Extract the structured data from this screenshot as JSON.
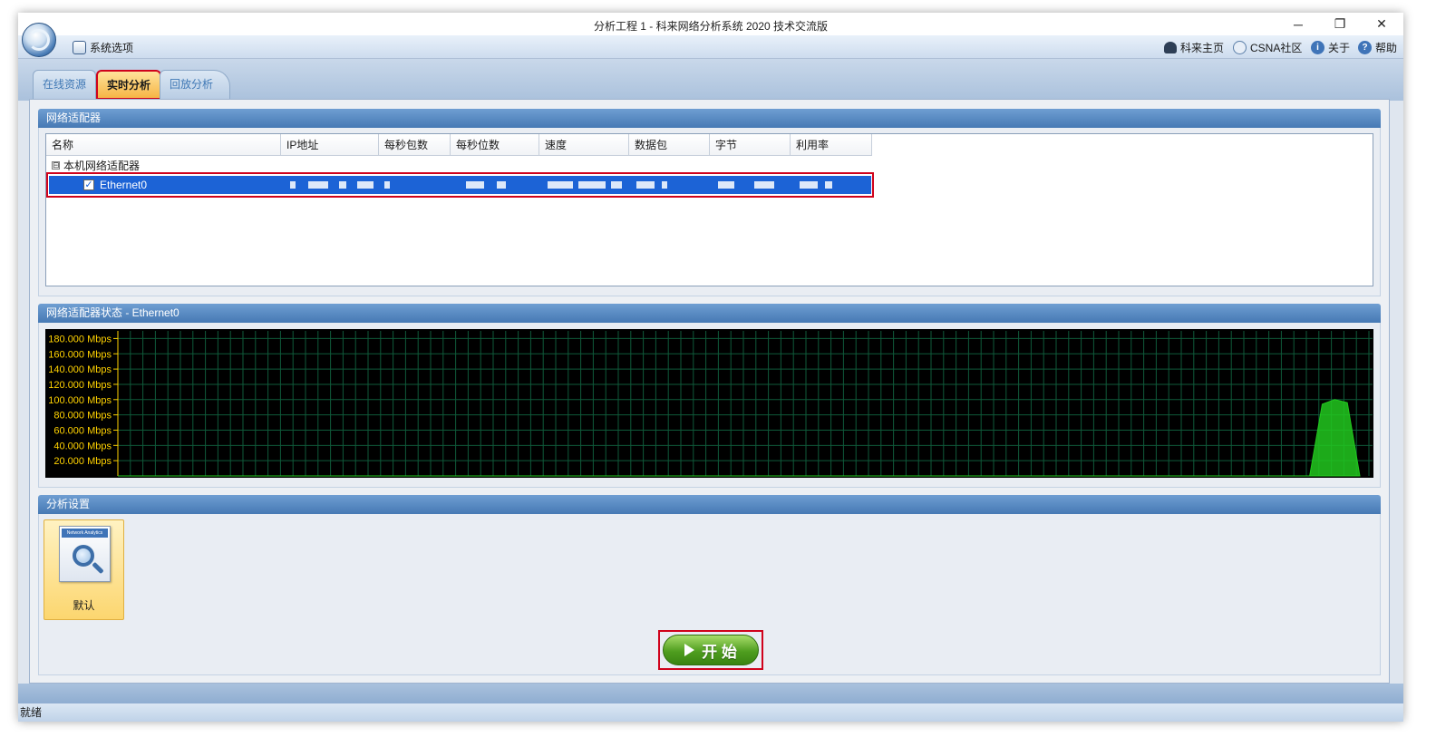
{
  "window": {
    "title": "分析工程 1 - 科来网络分析系统 2020 技术交流版",
    "controls": {
      "minimize": "─",
      "restore": "❐",
      "close": "✕"
    }
  },
  "menubar": {
    "left": [
      {
        "label": "系统选项",
        "icon": "settings-window-icon"
      }
    ],
    "right": [
      {
        "label": "科来主页",
        "icon": "home-logo-icon"
      },
      {
        "label": "CSNA社区",
        "icon": "community-icon"
      },
      {
        "label": "关于",
        "icon": "info-icon"
      },
      {
        "label": "帮助",
        "icon": "help-icon"
      }
    ]
  },
  "tabs": [
    {
      "label": "在线资源",
      "active": false
    },
    {
      "label": "实时分析",
      "active": true
    },
    {
      "label": "回放分析",
      "active": false
    }
  ],
  "adapters_section": {
    "title": "网络适配器",
    "columns": [
      "名称",
      "IP地址",
      "每秒包数",
      "每秒位数",
      "速度",
      "数据包",
      "字节",
      "利用率"
    ],
    "group_label": "本机网络适配器",
    "group_expander": "⊟",
    "rows": [
      {
        "name": "Ethernet0",
        "checked": true,
        "checkmark": "✓"
      }
    ]
  },
  "status_section": {
    "title": "网络适配器状态 - Ethernet0"
  },
  "chart_data": {
    "type": "area",
    "y_tick_labels": [
      "180.000 Mbps",
      "160.000 Mbps",
      "140.000 Mbps",
      "120.000 Mbps",
      "100.000 Mbps",
      "80.000 Mbps",
      "60.000 Mbps",
      "40.000 Mbps",
      "20.000 Mbps"
    ],
    "ylim": [
      0,
      190
    ],
    "grid": true,
    "x_points": 100,
    "values": [
      0,
      0,
      0,
      0,
      0,
      0,
      0,
      0,
      0,
      0,
      0,
      0,
      0,
      0,
      0,
      0,
      0,
      0,
      0,
      0,
      0,
      0,
      0,
      0,
      0,
      0,
      0,
      0,
      0,
      0,
      0,
      0,
      0,
      0,
      0,
      0,
      0,
      0,
      0,
      0,
      0,
      0,
      0,
      0,
      0,
      0,
      0,
      0,
      0,
      0,
      0,
      0,
      0,
      0,
      0,
      0,
      0,
      0,
      0,
      0,
      0,
      0,
      0,
      0,
      0,
      0,
      0,
      0,
      0,
      0,
      0,
      0,
      0,
      0,
      0,
      0,
      0,
      0,
      0,
      0,
      0,
      0,
      0,
      0,
      0,
      0,
      0,
      0,
      0,
      0,
      0,
      0,
      0,
      0,
      0,
      0,
      94,
      100,
      96,
      0
    ],
    "colors": {
      "background": "#000000",
      "grid": "#0f5a3a",
      "series": "#22c81e",
      "axis": "#ffd200",
      "labels": "#ffd200"
    }
  },
  "settings_section": {
    "title": "分析设置",
    "profile": {
      "label": "默认",
      "icon_caption": "Network Analytics"
    }
  },
  "start_button": {
    "label": "开 始"
  },
  "statusbar": {
    "text": "就绪"
  }
}
